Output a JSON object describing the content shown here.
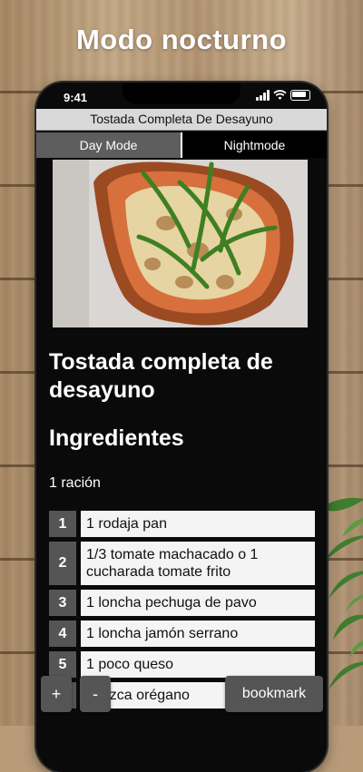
{
  "headline": "Modo nocturno",
  "status_bar": {
    "time": "9:41"
  },
  "app": {
    "title": "Tostada Completa De Desayuno",
    "tabs": [
      {
        "label": "Day Mode",
        "active": false
      },
      {
        "label": "Nightmode",
        "active": true
      }
    ]
  },
  "recipe": {
    "title": "Tostada completa de desayuno",
    "ingredients_heading": "Ingredientes",
    "servings": "1 ración",
    "ingredients": [
      {
        "num": "1",
        "text": "1 rodaja pan"
      },
      {
        "num": "2",
        "text": "1/3 tomate machacado o 1 cucharada tomate frito"
      },
      {
        "num": "3",
        "text": "1 loncha pechuga de pavo"
      },
      {
        "num": "4",
        "text": "1 loncha jamón serrano"
      },
      {
        "num": "5",
        "text": "1 poco queso"
      },
      {
        "num": "6",
        "text": "1 pizca orégano"
      }
    ]
  },
  "controls": {
    "zoom_in": "+",
    "zoom_out": "-",
    "bookmark": "bookmark"
  },
  "colors": {
    "night_bg": "#000000",
    "tab_inactive": "#5e5e5e",
    "ingredient_num_bg": "#555555",
    "ingredient_text_bg": "#f4f4f4"
  }
}
